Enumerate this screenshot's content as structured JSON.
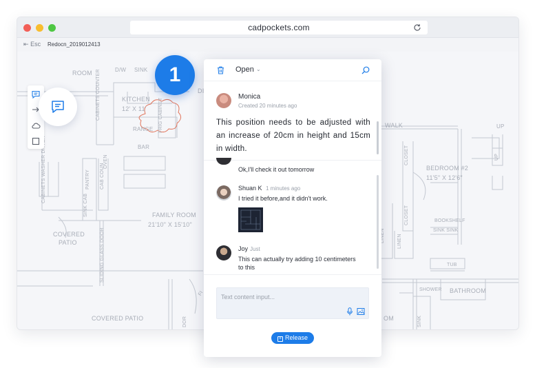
{
  "browser": {
    "url": "cadpockets.com",
    "esc_label": "Esc",
    "file_name": "Redocn_2019012413"
  },
  "floorplan": {
    "labels": {
      "room": "ROOM",
      "dw": "D/W",
      "sink": "SINK",
      "cabinets_counter": "CABINETS COUNTER",
      "fridge_cabinet": "FRIG CABINET",
      "din": "DIN",
      "kitchen": "KITCHEN",
      "kitchen_size": "12' X 11'",
      "range": "RANGE",
      "bar": "BAR",
      "pantry": "PANTRY",
      "cab_coun": "CAB COUN",
      "oven": "OVEN",
      "cabinets_washer": "CABINETS WASHER DRYER",
      "sink_cab": "SINK CAB",
      "family_room": "FAMILY ROOM",
      "family_size": "21'10\" X 15'10\"",
      "covered_patio_top": "COVERED",
      "patio": "PATIO",
      "sliding_door": "SLIDING GLASS DOOR",
      "covered_patio_bottom": "COVERED PATIO",
      "walk": "WALK",
      "up_1": "UP",
      "up_2": "UP",
      "closet_1": "CLOSET",
      "closet_2": "CLOSET",
      "bedroom": "BEDROOM #2",
      "bedroom_size": "11'5\" X 12'6\"",
      "linen_1": "LINEN",
      "linen_2": "LINEN",
      "bookshelf": "BOOKSHELF",
      "sink_sink": "SINK  SINK",
      "tub": "TUB",
      "shower": "SHOWER",
      "bathroom": "BATHROOM",
      "sink_small": "SINK",
      "om": "OM",
      "dor": "DOR",
      "fi": "FI"
    }
  },
  "tools": [
    "comment-tool",
    "arrow-tool",
    "cloud-tool",
    "rectangle-tool"
  ],
  "badge": {
    "number": "1"
  },
  "panel": {
    "status": "Open",
    "main_comment": {
      "author": "Monica",
      "meta": "Created 20 minutes ago",
      "text": "This position needs to be adjusted with an increase of 20cm in height and 15cm in width."
    },
    "replies": [
      {
        "author": "",
        "time": "",
        "text": "Ok,I'll check it out tomorrow"
      },
      {
        "author": "Shuan K",
        "time": "1 minutes ago",
        "text": "I tried it before,and it didn't work."
      },
      {
        "author": "Joy",
        "time": "Just",
        "text": "This can actually try adding 10 centimeters to this"
      }
    ],
    "input_placeholder": "Text content input...",
    "release_label": "Release"
  },
  "colors": {
    "accent": "#1d7ce8",
    "window_bar": "#eceef2",
    "floorplan_lines": "#b8bec8",
    "markup_cloud": "#e0735a"
  }
}
